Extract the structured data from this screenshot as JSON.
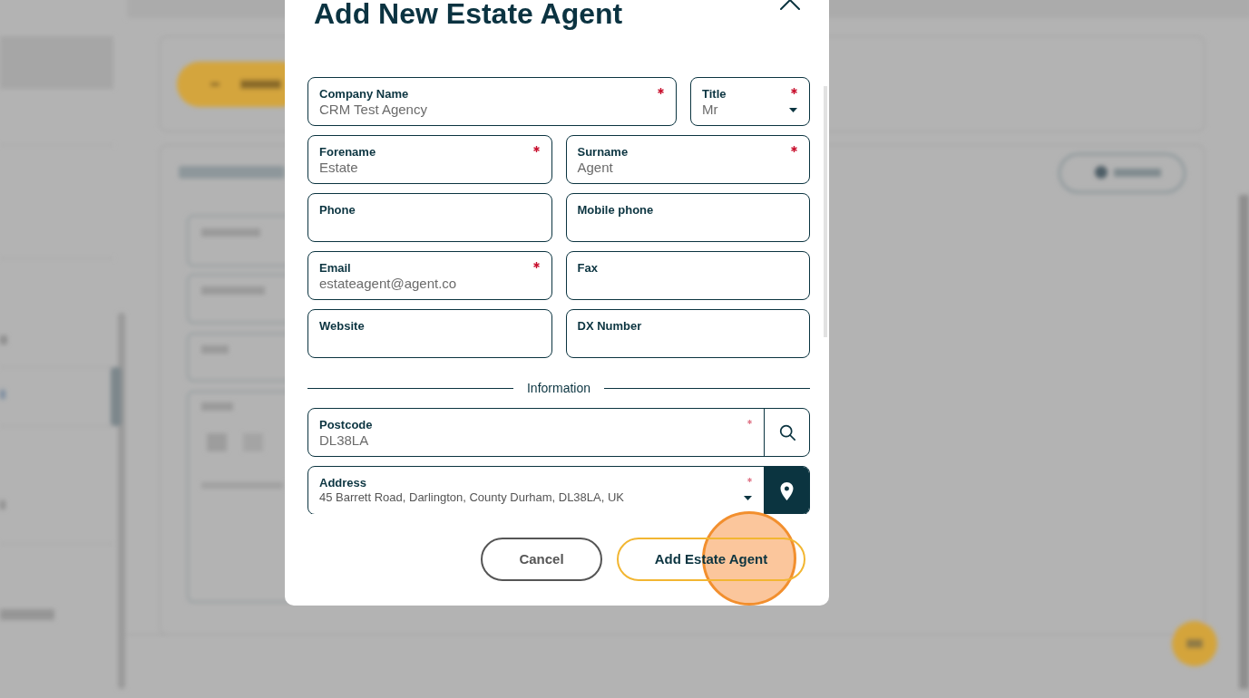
{
  "dialog": {
    "title": "Add New Estate Agent",
    "field_rows": [
      [
        {
          "kind": "text",
          "label": "Company Name",
          "value": "CRM Test Agency",
          "required": true
        },
        {
          "kind": "select",
          "label": "Title",
          "value": "Mr",
          "required": true
        }
      ],
      [
        {
          "kind": "text",
          "label": "Forename",
          "value": "Estate",
          "required": true
        },
        {
          "kind": "text",
          "label": "Surname",
          "value": "Agent",
          "required": true
        }
      ],
      [
        {
          "kind": "text",
          "label": "Phone",
          "required": false
        },
        {
          "kind": "text",
          "label": "Mobile phone",
          "required": false
        }
      ],
      [
        {
          "kind": "text",
          "label": "Email",
          "value": "estateagent@agent.co",
          "required": true
        },
        {
          "kind": "text",
          "label": "Fax",
          "required": false
        }
      ],
      [
        {
          "kind": "text",
          "label": "Website",
          "required": false
        },
        {
          "kind": "text",
          "label": "DX Number",
          "required": false
        }
      ]
    ],
    "section_label": "Information",
    "address_fields": [
      {
        "kind": "search",
        "label": "Postcode",
        "value": "DL38LA",
        "required": true
      },
      {
        "kind": "address",
        "label": "Address",
        "value": "45 Barrett Road, Darlington, County Durham, DL38LA, UK",
        "required": true
      }
    ],
    "buttons": [
      {
        "kind": "cancel",
        "label": "Cancel",
        "click_highlight": false
      },
      {
        "kind": "submit",
        "label": "Add Estate Agent",
        "click_highlight": true
      }
    ]
  }
}
